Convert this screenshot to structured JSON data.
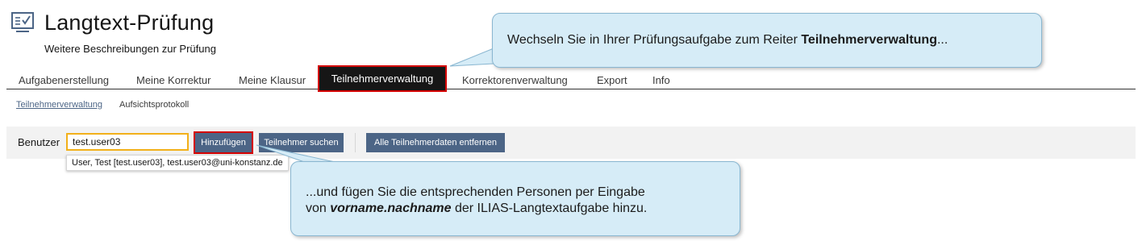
{
  "header": {
    "icon": "test-clipboard-icon",
    "title": "Langtext-Prüfung",
    "description": "Weitere Beschreibungen zur Prüfung"
  },
  "tabs": [
    {
      "label": "Aufgabenerstellung"
    },
    {
      "label": "Meine Korrektur"
    },
    {
      "label": "Meine Klausur"
    },
    {
      "label": "Teilnehmerverwaltung",
      "active": true
    },
    {
      "label": "Korrektorenverwaltung"
    },
    {
      "label": "Export"
    },
    {
      "label": "Info"
    }
  ],
  "subtabs": [
    {
      "label": "Teilnehmerverwaltung",
      "active": true
    },
    {
      "label": "Aufsichtsprotokoll"
    }
  ],
  "toolbar": {
    "user_label": "Benutzer",
    "user_input_value": "test.user03",
    "add_button": "Hinzufügen",
    "search_button": "Teilnehmer suchen",
    "remove_all_button": "Alle Teilnehmerdaten entfernen",
    "suggestion": "User, Test [test.user03], test.user03@uni-konstanz.de"
  },
  "callouts": {
    "first_prefix": "Wechseln Sie in Ihrer Prüfungsaufgabe zum Reiter ",
    "first_bold": "Teilnehmerverwaltung",
    "first_suffix": "...",
    "second_line1": "...und fügen Sie die entsprechenden Personen per Eingabe",
    "second_line2_prefix": "von ",
    "second_line2_bold": "vorname.nachname",
    "second_line2_suffix": " der ILIAS-Langtextaufgabe hinzu."
  },
  "colors": {
    "highlight_red": "#d40000",
    "focus_orange": "#f2b01a",
    "button_blue": "#4c6586",
    "callout_bg": "#d6ecf7"
  }
}
